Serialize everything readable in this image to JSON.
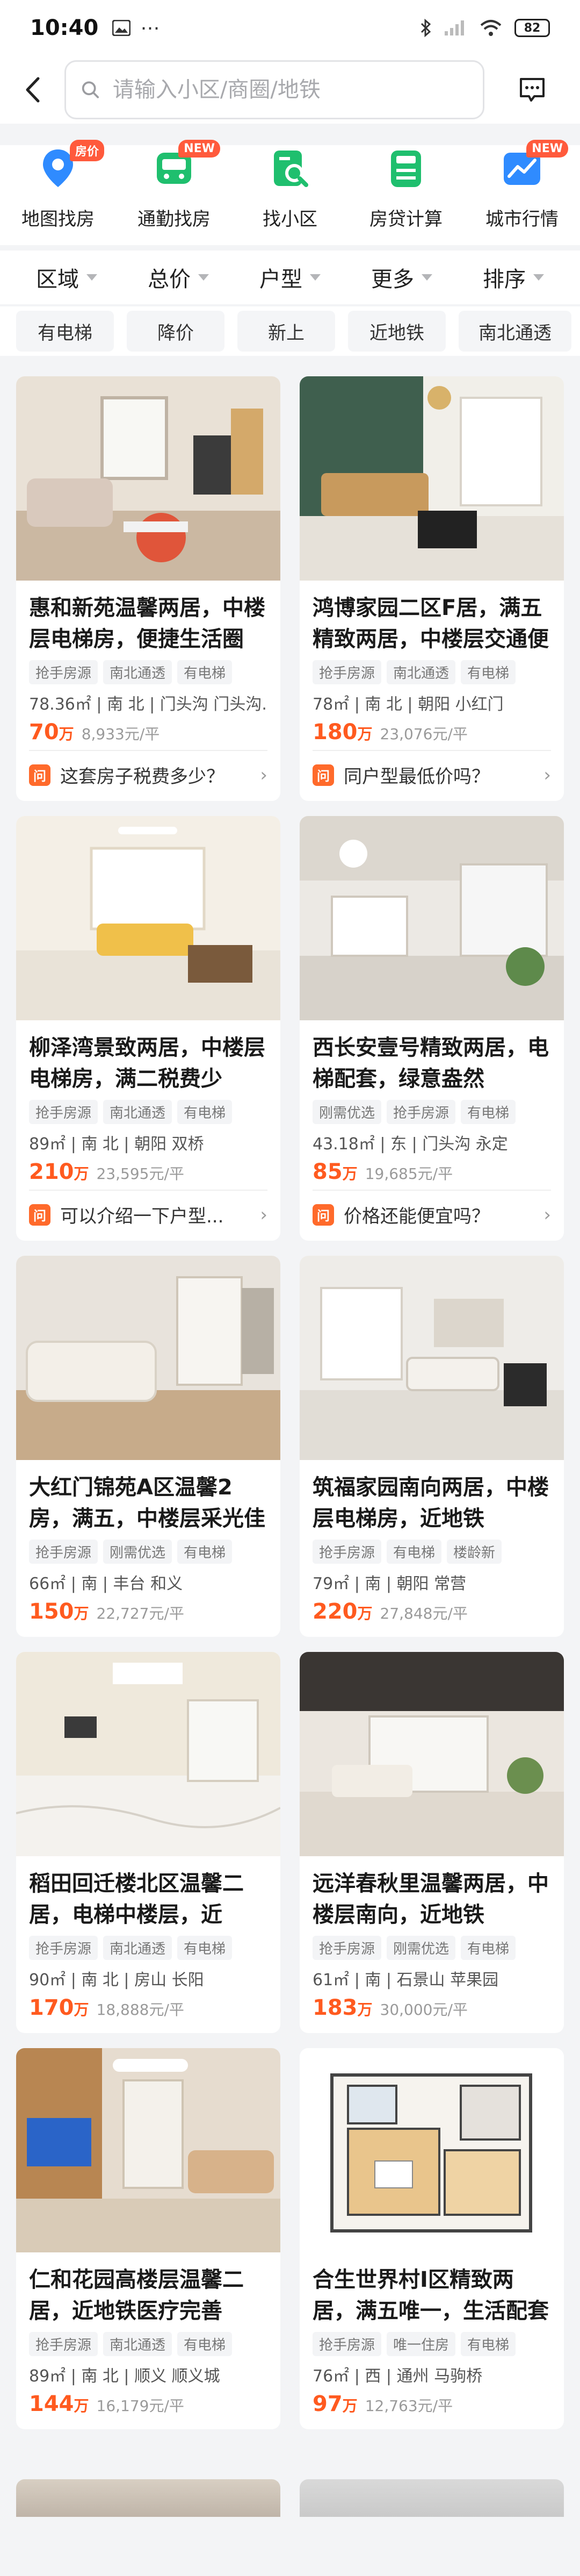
{
  "status": {
    "time": "10:40",
    "battery": "82"
  },
  "search": {
    "placeholder": "请输入小区/商圈/地铁"
  },
  "quick_nav": [
    {
      "label": "地图找房",
      "badge": "房价",
      "icon": "map-pin-icon",
      "color": "#2f8bff"
    },
    {
      "label": "通勤找房",
      "badge": "NEW",
      "icon": "commute-icon",
      "color": "#1fbf6e"
    },
    {
      "label": "找小区",
      "badge": "",
      "icon": "find-community-icon",
      "color": "#1fbf6e"
    },
    {
      "label": "房贷计算",
      "badge": "",
      "icon": "calculator-icon",
      "color": "#1fbf6e"
    },
    {
      "label": "城市行情",
      "badge": "NEW",
      "icon": "market-chart-icon",
      "color": "#2f8bff"
    }
  ],
  "filters": [
    "区域",
    "总价",
    "户型",
    "更多",
    "排序"
  ],
  "chips": [
    "有电梯",
    "降价",
    "新上",
    "近地铁",
    "南北通透"
  ],
  "listings": [
    {
      "title": "惠和新苑温馨两居，中楼层电梯房，便捷生活圈",
      "tags": [
        "抢手房源",
        "南北通透",
        "有电梯"
      ],
      "meta": "78.36㎡ | 南 北 | 门头沟 门头沟...",
      "price": "70",
      "price_unit": "万",
      "unit_price": "8,933元/平",
      "question": "这套房子税费多少？",
      "image": "living-room-photo"
    },
    {
      "title": "鸿博家园二区F居，满五精致两居，中楼层交通便利",
      "tags": [
        "抢手房源",
        "南北通透",
        "有电梯"
      ],
      "meta": "78㎡ | 南 北 | 朝阳 小红门",
      "price": "180",
      "price_unit": "万",
      "unit_price": "23,076元/平",
      "question": "同户型最低价吗？",
      "image": "green-wall-room-photo"
    },
    {
      "title": "柳泽湾景致两居，中楼层电梯房，满二税费少",
      "tags": [
        "抢手房源",
        "南北通透",
        "有电梯"
      ],
      "meta": "89㎡ | 南 北 | 朝阳 双桥",
      "price": "210",
      "price_unit": "万",
      "unit_price": "23,595元/平",
      "question": "可以介绍一下户型...",
      "image": "bright-living-room-photo"
    },
    {
      "title": "西长安壹号精致两居，电梯配套，绿意盎然",
      "tags": [
        "刚需优选",
        "抢手房源",
        "有电梯"
      ],
      "meta": "43.18㎡ | 东 | 门头沟 永定",
      "price": "85",
      "price_unit": "万",
      "unit_price": "19,685元/平",
      "question": "价格还能便宜吗？",
      "image": "loft-room-photo"
    },
    {
      "title": "大红门锦苑A区温馨2房，满五，中楼层采光佳",
      "tags": [
        "抢手房源",
        "刚需优选",
        "有电梯"
      ],
      "meta": "66㎡ | 南 | 丰台 和义",
      "price": "150",
      "price_unit": "万",
      "unit_price": "22,727元/平",
      "question": "",
      "image": "sofa-living-room-photo"
    },
    {
      "title": "筑福家园南向两居，中楼层电梯房，近地铁",
      "tags": [
        "抢手房源",
        "有电梯",
        "楼龄新"
      ],
      "meta": "79㎡ | 南 | 朝阳 常营",
      "price": "220",
      "price_unit": "万",
      "unit_price": "27,848元/平",
      "question": "",
      "image": "modern-living-room-photo"
    },
    {
      "title": "稻田回迁楼北区温馨二居，电梯中楼层，近绿...",
      "tags": [
        "抢手房源",
        "南北通透",
        "有电梯"
      ],
      "meta": "90㎡ | 南 北 | 房山 长阳",
      "price": "170",
      "price_unit": "万",
      "unit_price": "18,888元/平",
      "question": "",
      "image": "marble-floor-room-photo"
    },
    {
      "title": "远洋春秋里温馨两居，中楼层南向，近地铁",
      "tags": [
        "抢手房源",
        "刚需优选",
        "有电梯"
      ],
      "meta": "61㎡ | 南 | 石景山 苹果园",
      "price": "183",
      "price_unit": "万",
      "unit_price": "30,000元/平",
      "question": "",
      "image": "duplex-room-photo"
    },
    {
      "title": "仁和花园高楼层温馨二居，近地铁医疗完善",
      "tags": [
        "抢手房源",
        "南北通透",
        "有电梯"
      ],
      "meta": "89㎡ | 南 北 | 顺义 顺义城",
      "price": "144",
      "price_unit": "万",
      "unit_price": "16,179元/平",
      "question": "",
      "image": "tv-living-room-photo"
    },
    {
      "title": "合生世界村I区精致两居，满五唯一，生活配套丰富",
      "tags": [
        "抢手房源",
        "唯一住房",
        "有电梯"
      ],
      "meta": "76㎡ | 西 | 通州 马驹桥",
      "price": "97",
      "price_unit": "万",
      "unit_price": "12,763元/平",
      "question": "",
      "image": "floor-plan-image"
    }
  ]
}
